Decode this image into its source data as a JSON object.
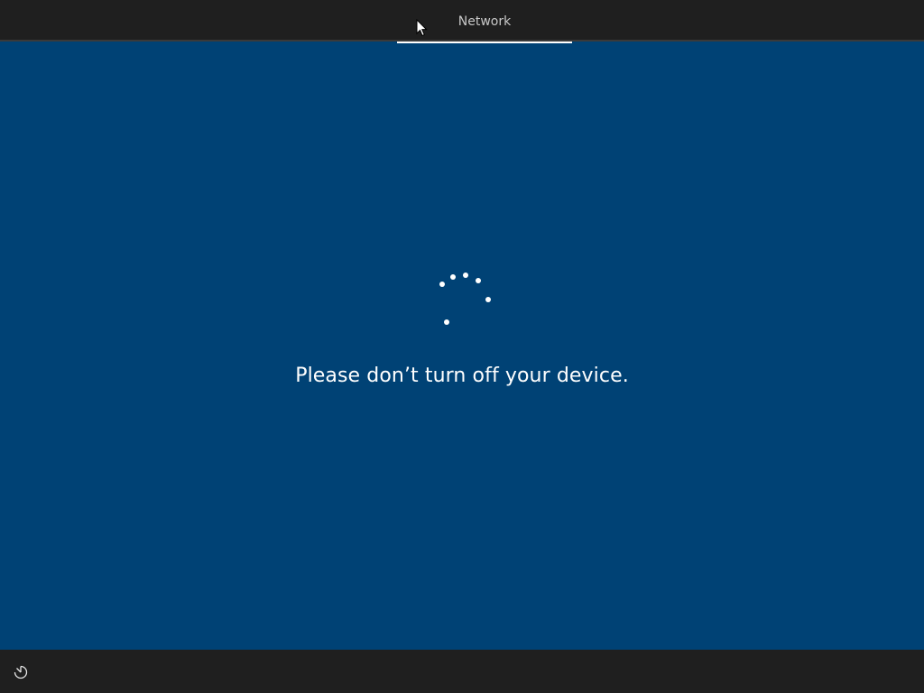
{
  "header": {
    "tabs": [
      {
        "label": "Network",
        "active": true
      }
    ]
  },
  "main": {
    "status_message": "Please don’t turn off your device.",
    "spinner_icon": "loading-spinner-icon"
  },
  "footer": {
    "ease_of_access_icon": "ease-of-access-icon"
  },
  "colors": {
    "background": "#004275",
    "bars": "#1f1f1f",
    "text": "#ffffff",
    "tab_text": "#c8c8c8"
  }
}
